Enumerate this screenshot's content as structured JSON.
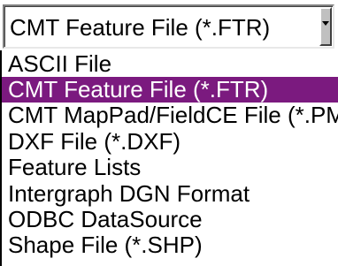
{
  "combo": {
    "value": "CMT Feature File (*.FTR)",
    "arrow_icon": "chevron-down-icon"
  },
  "list": {
    "items": [
      {
        "label": "ASCII File"
      },
      {
        "label": "CMT Feature File (*.FTR)"
      },
      {
        "label": "CMT MapPad/FieldCE File (*.PM"
      },
      {
        "label": "DXF File (*.DXF)"
      },
      {
        "label": "Feature Lists"
      },
      {
        "label": "Intergraph DGN Format"
      },
      {
        "label": "ODBC DataSource"
      },
      {
        "label": "Shape File (*.SHP)"
      }
    ],
    "selected_index": 1,
    "selected_color": "#7b1a7f"
  }
}
